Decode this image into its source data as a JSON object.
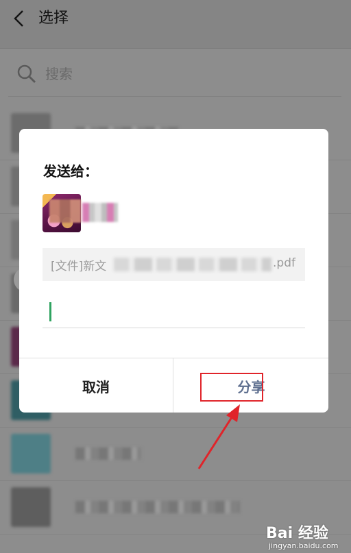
{
  "header": {
    "title": "选择"
  },
  "search": {
    "placeholder": "搜索"
  },
  "dialog": {
    "heading": "发送给：",
    "file": {
      "label_prefix": "[文件]新文",
      "ext": ".pdf"
    },
    "message": {
      "value": ""
    },
    "cancel_label": "取消",
    "share_label": "分享"
  },
  "watermark": {
    "logo": "Bai 经验",
    "sub": "jingyan.baidu.com"
  },
  "colors": {
    "accent_green": "#2fa360",
    "highlight_red": "#e0242a",
    "share_text": "#5e6f8f"
  }
}
